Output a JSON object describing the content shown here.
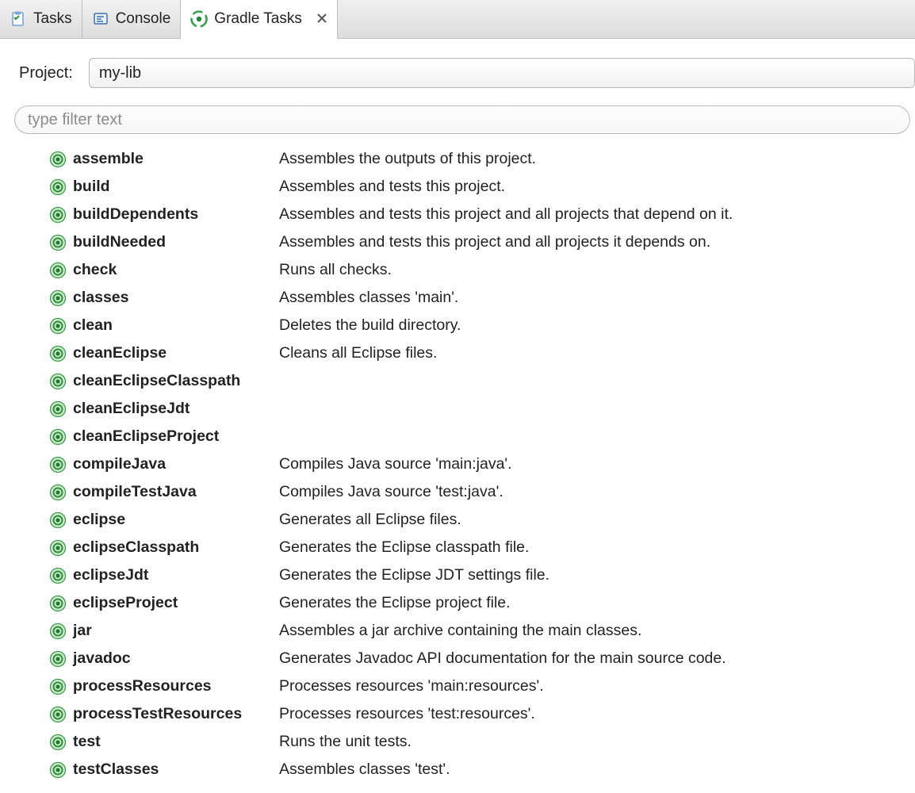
{
  "tabs": [
    {
      "label": "Tasks",
      "icon": "tasks-icon",
      "active": false
    },
    {
      "label": "Console",
      "icon": "console-icon",
      "active": false
    },
    {
      "label": "Gradle Tasks",
      "icon": "gradle-icon",
      "active": true
    }
  ],
  "project": {
    "label": "Project:",
    "value": "my-lib"
  },
  "filter": {
    "placeholder": "type filter text"
  },
  "tasks": [
    {
      "name": "assemble",
      "desc": "Assembles the outputs of this project."
    },
    {
      "name": "build",
      "desc": "Assembles and tests this project."
    },
    {
      "name": "buildDependents",
      "desc": "Assembles and tests this project and all projects that depend on it."
    },
    {
      "name": "buildNeeded",
      "desc": "Assembles and tests this project and all projects it depends on."
    },
    {
      "name": "check",
      "desc": "Runs all checks."
    },
    {
      "name": "classes",
      "desc": "Assembles classes 'main'."
    },
    {
      "name": "clean",
      "desc": "Deletes the build directory."
    },
    {
      "name": "cleanEclipse",
      "desc": "Cleans all Eclipse files."
    },
    {
      "name": "cleanEclipseClasspath",
      "desc": ""
    },
    {
      "name": "cleanEclipseJdt",
      "desc": ""
    },
    {
      "name": "cleanEclipseProject",
      "desc": ""
    },
    {
      "name": "compileJava",
      "desc": "Compiles Java source 'main:java'."
    },
    {
      "name": "compileTestJava",
      "desc": "Compiles Java source 'test:java'."
    },
    {
      "name": "eclipse",
      "desc": "Generates all Eclipse files."
    },
    {
      "name": "eclipseClasspath",
      "desc": "Generates the Eclipse classpath file."
    },
    {
      "name": "eclipseJdt",
      "desc": "Generates the Eclipse JDT settings file."
    },
    {
      "name": "eclipseProject",
      "desc": "Generates the Eclipse project file."
    },
    {
      "name": "jar",
      "desc": "Assembles a jar archive containing the main classes."
    },
    {
      "name": "javadoc",
      "desc": "Generates Javadoc API documentation for the main source code."
    },
    {
      "name": "processResources",
      "desc": "Processes resources 'main:resources'."
    },
    {
      "name": "processTestResources",
      "desc": "Processes resources 'test:resources'."
    },
    {
      "name": "test",
      "desc": "Runs the unit tests."
    },
    {
      "name": "testClasses",
      "desc": "Assembles classes 'test'."
    }
  ]
}
